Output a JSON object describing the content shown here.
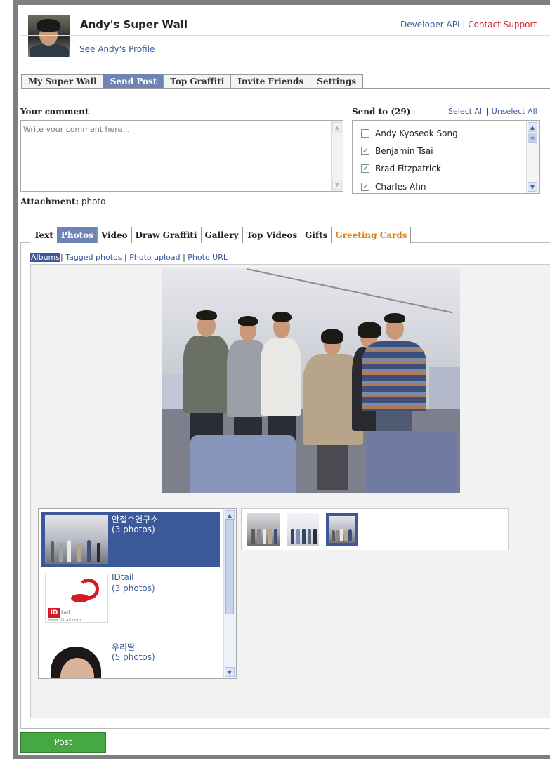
{
  "header": {
    "title": "Andy's Super Wall",
    "profile_link": "See Andy's Profile",
    "developer_api": "Developer API",
    "separator": "|",
    "contact_support": "Contact Support"
  },
  "main_tabs": [
    {
      "label": "My Super Wall",
      "active": false
    },
    {
      "label": "Send Post",
      "active": true
    },
    {
      "label": "Top Graffiti",
      "active": false
    },
    {
      "label": "Invite Friends",
      "active": false
    },
    {
      "label": "Settings",
      "active": false
    }
  ],
  "comment": {
    "label": "Your comment",
    "placeholder": "Write your comment here..."
  },
  "send_to": {
    "label": "Send to",
    "count": "(29)",
    "select_all": "Select All",
    "separator": "|",
    "unselect_all": "Unselect All",
    "friends": [
      {
        "name": "Andy Kyoseok Song",
        "checked": false
      },
      {
        "name": "Benjamin Tsai",
        "checked": true
      },
      {
        "name": "Brad Fitzpatrick",
        "checked": true
      },
      {
        "name": "Charles Ahn",
        "checked": true
      }
    ]
  },
  "attachment": {
    "label": "Attachment:",
    "value": "photo"
  },
  "attachment_tabs": [
    {
      "label": "Text",
      "active": false
    },
    {
      "label": "Photos",
      "active": true
    },
    {
      "label": "Video",
      "active": false
    },
    {
      "label": "Draw Graffiti",
      "active": false
    },
    {
      "label": "Gallery",
      "active": false
    },
    {
      "label": "Top Videos",
      "active": false
    },
    {
      "label": "Gifts",
      "active": false
    },
    {
      "label": "Greeting Cards",
      "active": false
    }
  ],
  "photo_sources": {
    "albums": "Albums",
    "tagged": "Tagged photos",
    "upload": "Photo upload",
    "url": "Photo URL",
    "separator": "|"
  },
  "albums": [
    {
      "name": "안철수연구소",
      "count": "(3 photos)",
      "selected": true
    },
    {
      "name": "IDtail",
      "count": "(3 photos)",
      "selected": false
    },
    {
      "name": "우리딸",
      "count": "(5 photos)",
      "selected": false
    }
  ],
  "album_thumbs_count": 3,
  "selected_thumb_index": 2,
  "idtail_logo_text": "ID tail",
  "idtail_url": "www.IDtail.com",
  "post_button": "Post",
  "colors": {
    "tab_active": "#6d84b4",
    "link": "#3b5998",
    "support_red": "#d3262e",
    "greeting_orange": "#d9831c",
    "post_green": "#46a842"
  }
}
